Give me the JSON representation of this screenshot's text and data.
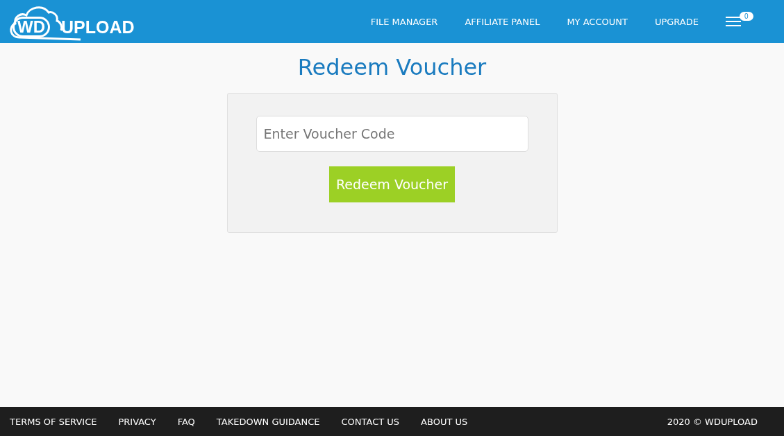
{
  "logo": {
    "part_1": "WD",
    "part_2": "UPLOAD"
  },
  "nav": [
    {
      "label": "FILE MANAGER"
    },
    {
      "label": "AFFILIATE PANEL"
    },
    {
      "label": "MY ACCOUNT"
    },
    {
      "label": "UPGRADE"
    }
  ],
  "menu_badge": "0",
  "page_title": "Redeem Voucher",
  "voucher_field": {
    "placeholder": "Enter Voucher Code"
  },
  "redeem_button": "Redeem Voucher",
  "footer_links": [
    {
      "label": "TERMS OF SERVICE"
    },
    {
      "label": "PRIVACY"
    },
    {
      "label": "FAQ"
    },
    {
      "label": "TAKEDOWN GUIDANCE"
    },
    {
      "label": "CONTACT US"
    },
    {
      "label": "ABOUT US"
    }
  ],
  "copyright": "2020 © WDUPLOAD"
}
